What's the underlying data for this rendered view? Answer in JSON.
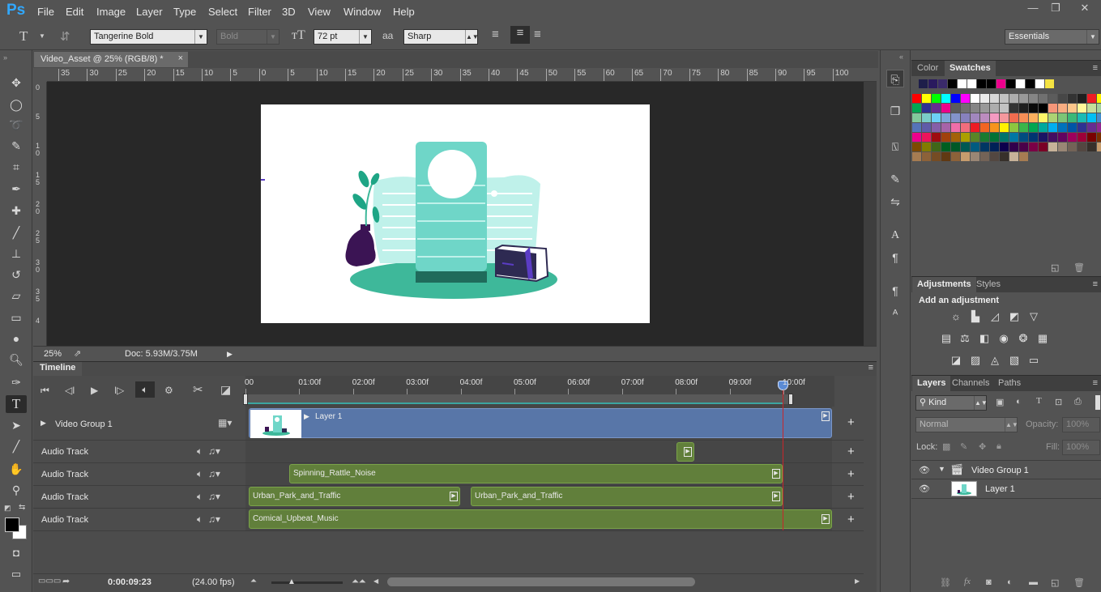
{
  "app": {
    "logo": "Ps"
  },
  "menu": [
    "File",
    "Edit",
    "Image",
    "Layer",
    "Type",
    "Select",
    "Filter",
    "3D",
    "View",
    "Window",
    "Help"
  ],
  "window_controls": [
    "—",
    "❐",
    "✕"
  ],
  "options": {
    "font_family": "Tangerine Bold",
    "font_style": "Bold",
    "font_size": "72 pt",
    "antialias_icon": "aa",
    "antialias": "Sharp",
    "workspace": "Essentials"
  },
  "document": {
    "tab_title": "Video_Asset @ 25% (RGB/8) *",
    "close": "×",
    "zoom": "25%",
    "doc_size": "Doc: 5.93M/3.75M",
    "h_ruler": [
      "35",
      "30",
      "25",
      "20",
      "15",
      "10",
      "5",
      "0",
      "5",
      "10",
      "15",
      "20",
      "25",
      "30",
      "35",
      "40",
      "45",
      "50",
      "55",
      "60",
      "65",
      "70",
      "75",
      "80",
      "85",
      "90",
      "95",
      "100"
    ],
    "v_ruler": [
      "0",
      "5",
      "1 0",
      "1 5",
      "2 0",
      "2 5",
      "3 0",
      "3 5",
      "4"
    ]
  },
  "timeline": {
    "title": "Timeline",
    "ticks": [
      "00",
      "01:00f",
      "02:00f",
      "03:00f",
      "04:00f",
      "05:00f",
      "06:00f",
      "07:00f",
      "08:00f",
      "09:00f",
      "10:00f"
    ],
    "current_time": "0:00:09:23",
    "fps": "(24.00 fps)",
    "video_group": {
      "name": "Video Group 1",
      "clip": "Layer 1"
    },
    "audio_tracks": [
      {
        "name": "Audio Track",
        "clips": []
      },
      {
        "name": "Audio Track",
        "clips": [
          "Spinning_Rattle_Noise"
        ]
      },
      {
        "name": "Audio Track",
        "clips": [
          "Urban_Park_and_Traffic",
          "Urban_Park_and_Traffic"
        ]
      },
      {
        "name": "Audio Track",
        "clips": [
          "Comical_Upbeat_Music"
        ]
      }
    ],
    "add": "+"
  },
  "panels": {
    "color_tabs": [
      "Color",
      "Swatches"
    ],
    "adjust_tabs": [
      "Adjustments",
      "Styles"
    ],
    "add_adjustment": "Add an adjustment",
    "layers_tabs": [
      "Layers",
      "Channels",
      "Paths"
    ],
    "kind": "Kind",
    "blend_mode": "Normal",
    "opacity_label": "Opacity:",
    "opacity": "100%",
    "lock_label": "Lock:",
    "fill_label": "Fill:",
    "fill": "100%",
    "layers": [
      {
        "name": "Video Group 1"
      },
      {
        "name": "Layer 1"
      }
    ]
  },
  "colors": {
    "accent_blue": "#31a8ff",
    "clip_green": "#617f3b",
    "video_clip_blue": "#5876a8",
    "playhead_red": "#c8262b",
    "teal": "#6fd6c8",
    "purple": "#3b1454"
  }
}
